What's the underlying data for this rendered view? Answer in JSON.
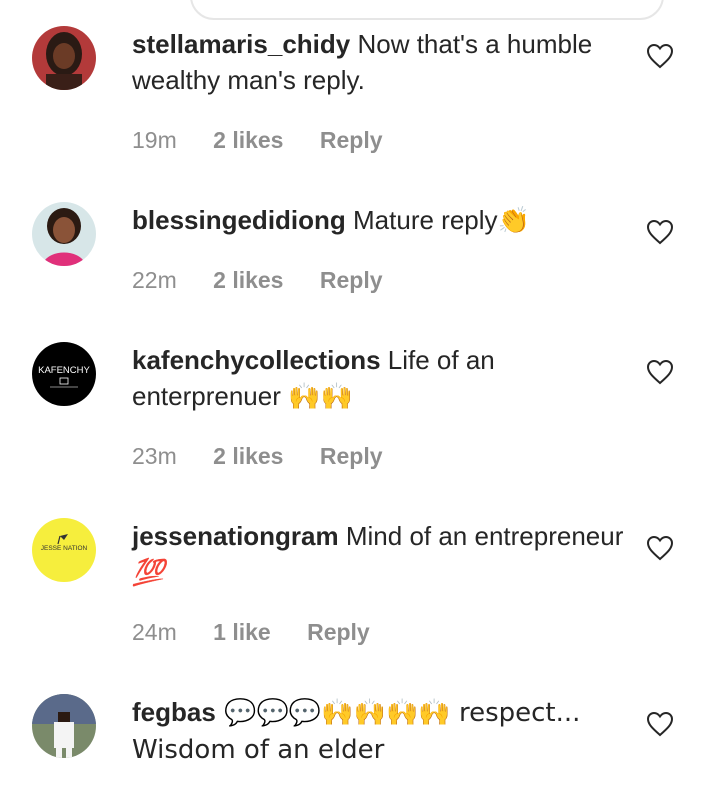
{
  "comments": [
    {
      "username": "stellamaris_chidy",
      "text": " Now that's a humble wealthy man's reply.",
      "emoji": "",
      "time": "19m",
      "likes": "2 likes",
      "reply": "Reply",
      "avatar_icon": "profile-photo"
    },
    {
      "username": "blessingedidiong",
      "text": " Mature reply",
      "emoji": "👏",
      "time": "22m",
      "likes": "2 likes",
      "reply": "Reply",
      "avatar_icon": "profile-photo"
    },
    {
      "username": "kafenchycollections",
      "text": " Life of an enterprenuer ",
      "emoji": "🙌🙌",
      "time": "23m",
      "likes": "2 likes",
      "reply": "Reply",
      "avatar_icon": "kafenchy-logo",
      "avatar_logo_text": "KAFENCHY"
    },
    {
      "username": "jessenationgram",
      "text": " Mind of an entrepreneur ",
      "emoji": "💯",
      "time": "24m",
      "likes": "1 like",
      "reply": "Reply",
      "avatar_icon": "jesse-nation-logo",
      "avatar_logo_text": "JESSE NATION"
    },
    {
      "username": "fegbas",
      "text": " 💬💬💬🙌🙌🙌🙌 respect... Wisdom of an elder",
      "emoji": "",
      "time": "",
      "likes": "",
      "reply": "",
      "avatar_icon": "profile-photo"
    }
  ],
  "colors": {
    "text": "#262626",
    "meta": "#8e8e8e",
    "heart": "#262626"
  }
}
